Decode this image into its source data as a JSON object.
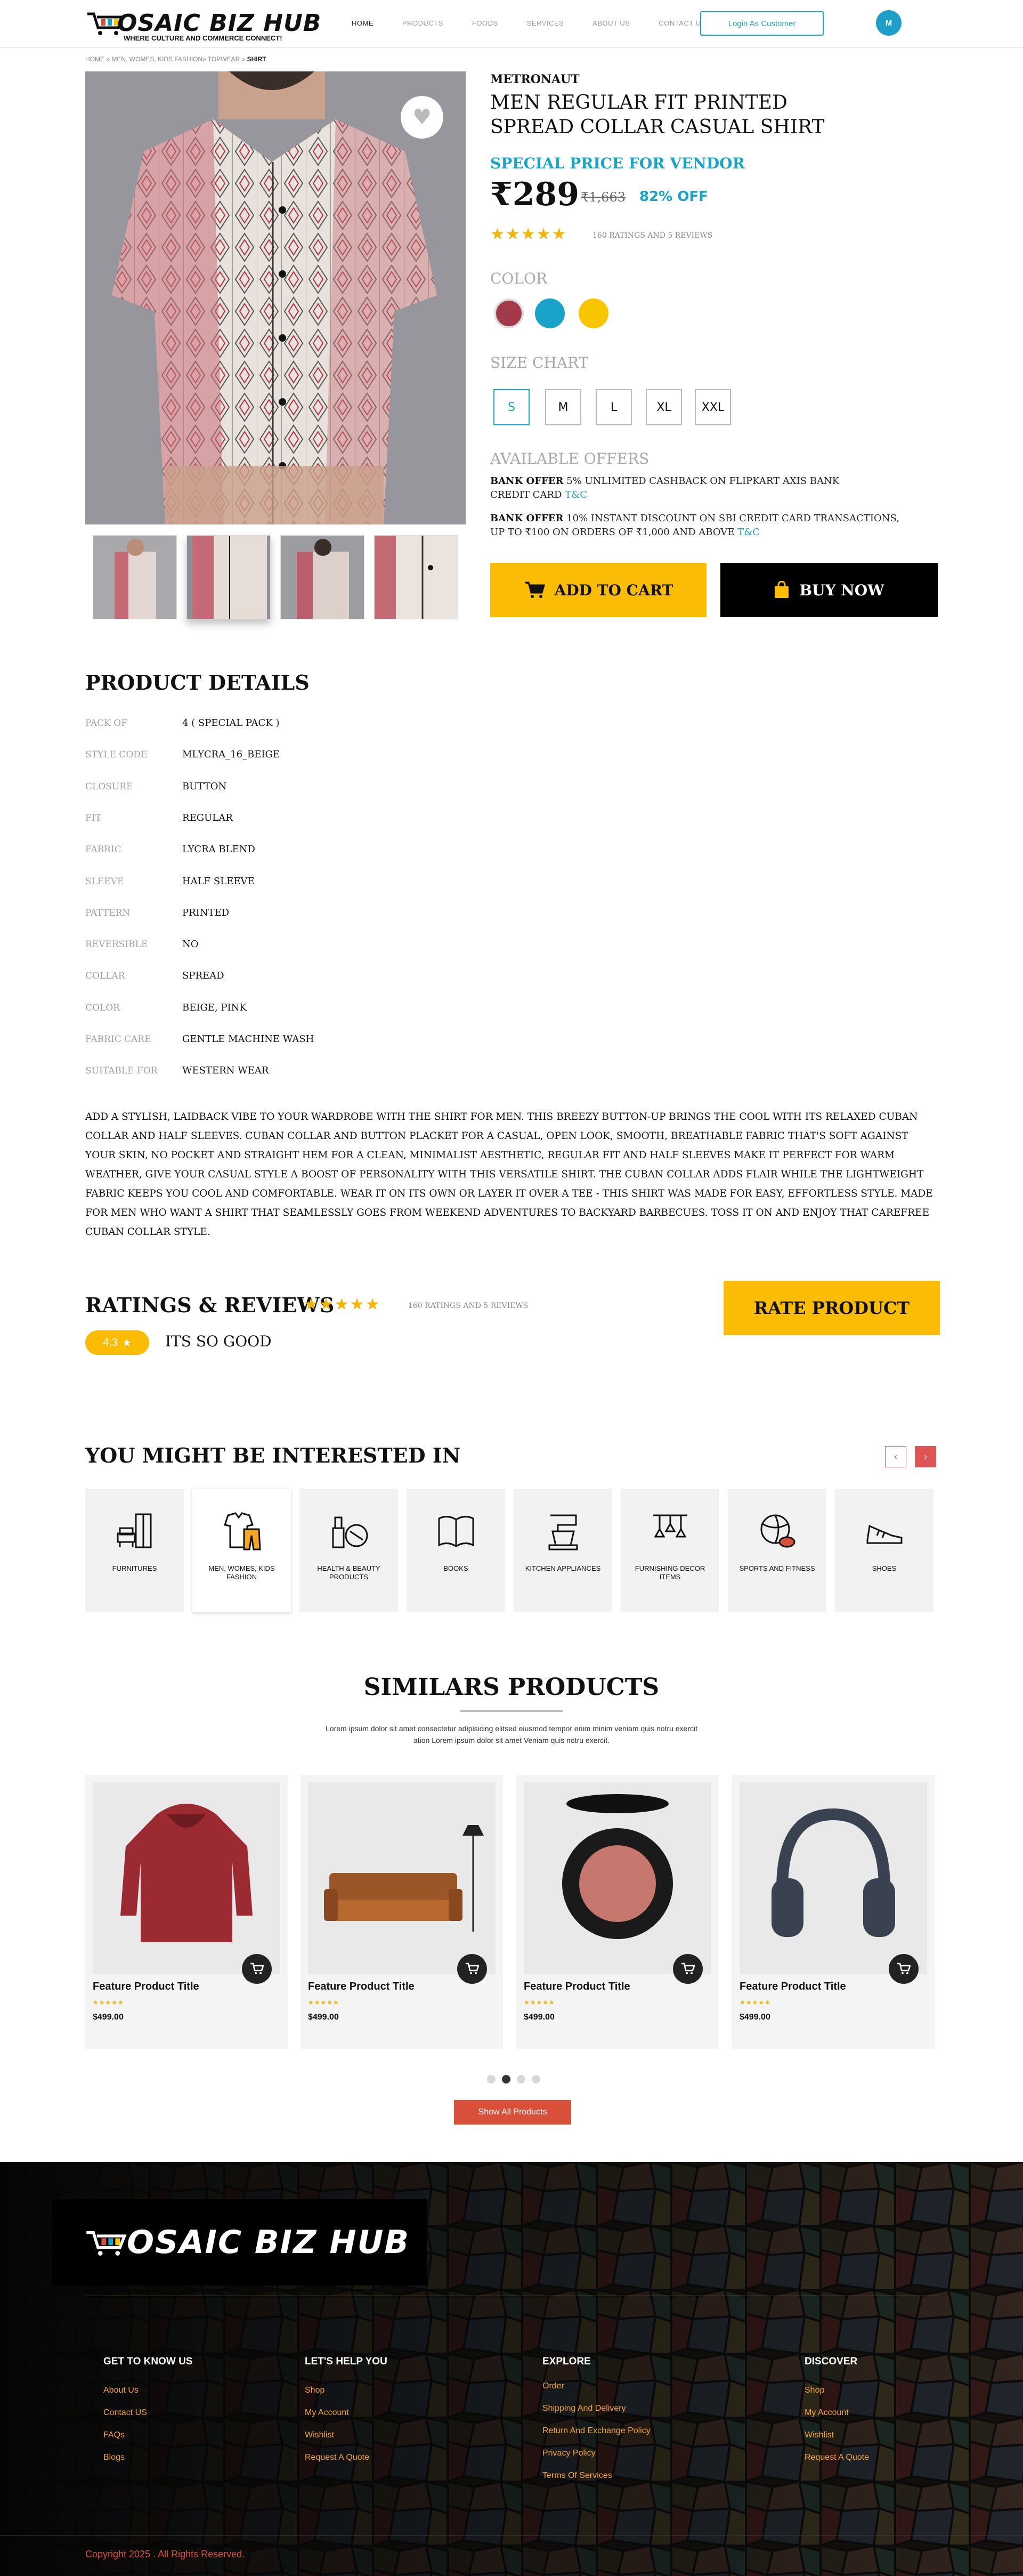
{
  "header": {
    "logo_text": "OSAIC BIZ HUB",
    "logo_tagline": "WHERE CULTURE AND COMMERCE CONNECT!",
    "nav": [
      "HOME",
      "PRODUCTS",
      "FOODS",
      "SERVICES",
      "ABOUT US",
      "CONTACT US"
    ],
    "active_nav": "HOME",
    "login_label": "Login As Customer",
    "avatar_initial": "M"
  },
  "breadcrumb": {
    "path": "HOME » MEN, WOMES, KIDS FASHION» TOPWEAR » ",
    "current": "SHIRT"
  },
  "product": {
    "brand": "METRONAUT",
    "title": "MEN REGULAR FIT PRINTED SPREAD COLLAR CASUAL SHIRT",
    "special_label": "SPECIAL PRICE FOR VENDOR",
    "price": "₹289",
    "mrp": "₹1,663",
    "discount": "82% OFF",
    "rating_value": 4.5,
    "stars": "★★★★★",
    "ratings_text": "160 RATINGS AND 5 REVIEWS",
    "color_label": "COLOR",
    "colors": [
      "#a23a4a",
      "#1aa3c9",
      "#f9c500"
    ],
    "size_label": "SIZE CHART",
    "sizes": [
      "S",
      "M",
      "L",
      "XL",
      "XXL"
    ],
    "selected_size": "S",
    "offers_label": "AVAILABLE OFFERS",
    "offers": [
      {
        "tag": "BANK OFFER",
        "text": "5% UNLIMITED CASHBACK ON FLIPKART AXIS BANK CREDIT CARD",
        "link": "T&C"
      },
      {
        "tag": "BANK OFFER",
        "text": "10% INSTANT DISCOUNT ON SBI CREDIT CARD TRANSACTIONS, UP TO ₹100 ON ORDERS OF ₹1,000 AND ABOVE",
        "link": "T&C"
      }
    ],
    "add_to_cart": "ADD TO CART",
    "buy_now": "BUY NOW"
  },
  "details": {
    "title": "PRODUCT DETAILS",
    "rows": [
      {
        "label": "PACK OF",
        "value": "4 ( SPECIAL PACK )"
      },
      {
        "label": "STYLE CODE",
        "value": "MLYCRA_16_BEIGE"
      },
      {
        "label": "CLOSURE",
        "value": "BUTTON"
      },
      {
        "label": "FIT",
        "value": "REGULAR"
      },
      {
        "label": "FABRIC",
        "value": "LYCRA BLEND"
      },
      {
        "label": "SLEEVE",
        "value": "HALF SLEEVE"
      },
      {
        "label": "PATTERN",
        "value": "PRINTED"
      },
      {
        "label": "REVERSIBLE",
        "value": "NO"
      },
      {
        "label": "COLLAR",
        "value": "SPREAD"
      },
      {
        "label": "COLOR",
        "value": "BEIGE, PINK"
      },
      {
        "label": "FABRIC CARE",
        "value": "GENTLE MACHINE WASH"
      },
      {
        "label": "SUITABLE FOR",
        "value": "WESTERN WEAR"
      }
    ],
    "description": "ADD A STYLISH, LAIDBACK VIBE TO YOUR WARDROBE WITH THE SHIRT FOR MEN. THIS BREEZY BUTTON-UP BRINGS THE COOL WITH ITS RELAXED CUBAN COLLAR AND HALF SLEEVES. CUBAN COLLAR AND BUTTON PLACKET FOR A CASUAL, OPEN LOOK, SMOOTH, BREATHABLE FABRIC THAT'S SOFT AGAINST YOUR SKIN, NO POCKET AND STRAIGHT HEM FOR A CLEAN, MINIMALIST AESTHETIC, REGULAR FIT AND HALF SLEEVES MAKE IT PERFECT FOR WARM WEATHER, GIVE YOUR CASUAL STYLE A BOOST OF PERSONALITY WITH THIS VERSATILE SHIRT. THE CUBAN COLLAR ADDS FLAIR WHILE THE LIGHTWEIGHT FABRIC KEEPS YOU COOL AND COMFORTABLE. WEAR IT ON ITS OWN OR LAYER IT OVER A TEE - THIS SHIRT WAS MADE FOR EASY, EFFORTLESS STYLE. MADE FOR MEN WHO WANT A SHIRT THAT SEAMLESSLY GOES FROM WEEKEND ADVENTURES TO BACKYARD BARBECUES. TOSS IT ON AND ENJOY THAT CAREFREE CUBAN COLLAR STYLE."
  },
  "reviews": {
    "title": "RATINGS & REVIEWS",
    "stars": "★★★★★",
    "ratings_text": "160 RATINGS AND 5 REVIEWS",
    "rate_button": "RATE PRODUCT",
    "score": "4.3",
    "review_text": "ITS SO GOOD"
  },
  "interested": {
    "title": "YOU MIGHT BE INTERESTED IN",
    "prev": "‹",
    "next": "›",
    "categories": [
      "FURNITURES",
      "MEN, WOMES, KIDS FASHION",
      "HEALTH &  BEAUTY PRODUCTS",
      "BOOKS",
      "KITCHEN APPLIANCES",
      "FURNISHING DECOR ITEMS",
      "SPORTS AND FITNESS",
      "SHOES"
    ],
    "selected": "MEN, WOMES, KIDS FASHION"
  },
  "similar": {
    "title": "SIMILARS PRODUCTS",
    "subtitle": "Lorem ipsum dolor sit amet consectetur adipisicing elitsed eiusmod tempor enim minim veniam quis notru exercit ation Lorem ipsum dolor sit amet Veniam quis notru exercit.",
    "products": [
      {
        "title": "Feature Product Title",
        "stars": "★★★★★",
        "price": "$499.00",
        "icon": "hoodie"
      },
      {
        "title": "Feature Product Title",
        "stars": "★★★★★",
        "price": "$499.00",
        "icon": "sofa"
      },
      {
        "title": "Feature Product Title",
        "stars": "★★★★★",
        "price": "$499.00",
        "icon": "blush-compact"
      },
      {
        "title": "Feature Product Title",
        "stars": "★★★★★",
        "price": "$499.00",
        "icon": "headphones"
      }
    ],
    "active_page": 2,
    "page_count": 4,
    "show_all": "Show All Products"
  },
  "footer": {
    "logo_text": "OSAIC BIZ HUB",
    "columns": [
      {
        "title": "GET TO KNOW US",
        "links": [
          "About Us",
          "Contact US",
          "FAQs",
          "Blogs"
        ]
      },
      {
        "title": "LET'S HELP YOU",
        "links": [
          "Shop",
          "My Account",
          "Wishlist",
          "Request A Quote"
        ]
      },
      {
        "title": "EXPLORE",
        "links": [
          "Order",
          "Shipping And Delivery",
          "Return And Exchange Policy",
          "Privacy Policy",
          "Terms Of Services"
        ]
      },
      {
        "title": "DISCOVER",
        "links": [
          "Shop",
          "My Account",
          "Wishlist",
          "Request A Quote"
        ]
      }
    ],
    "copyright": "Copyright 2025 . All Rights Reserved."
  }
}
